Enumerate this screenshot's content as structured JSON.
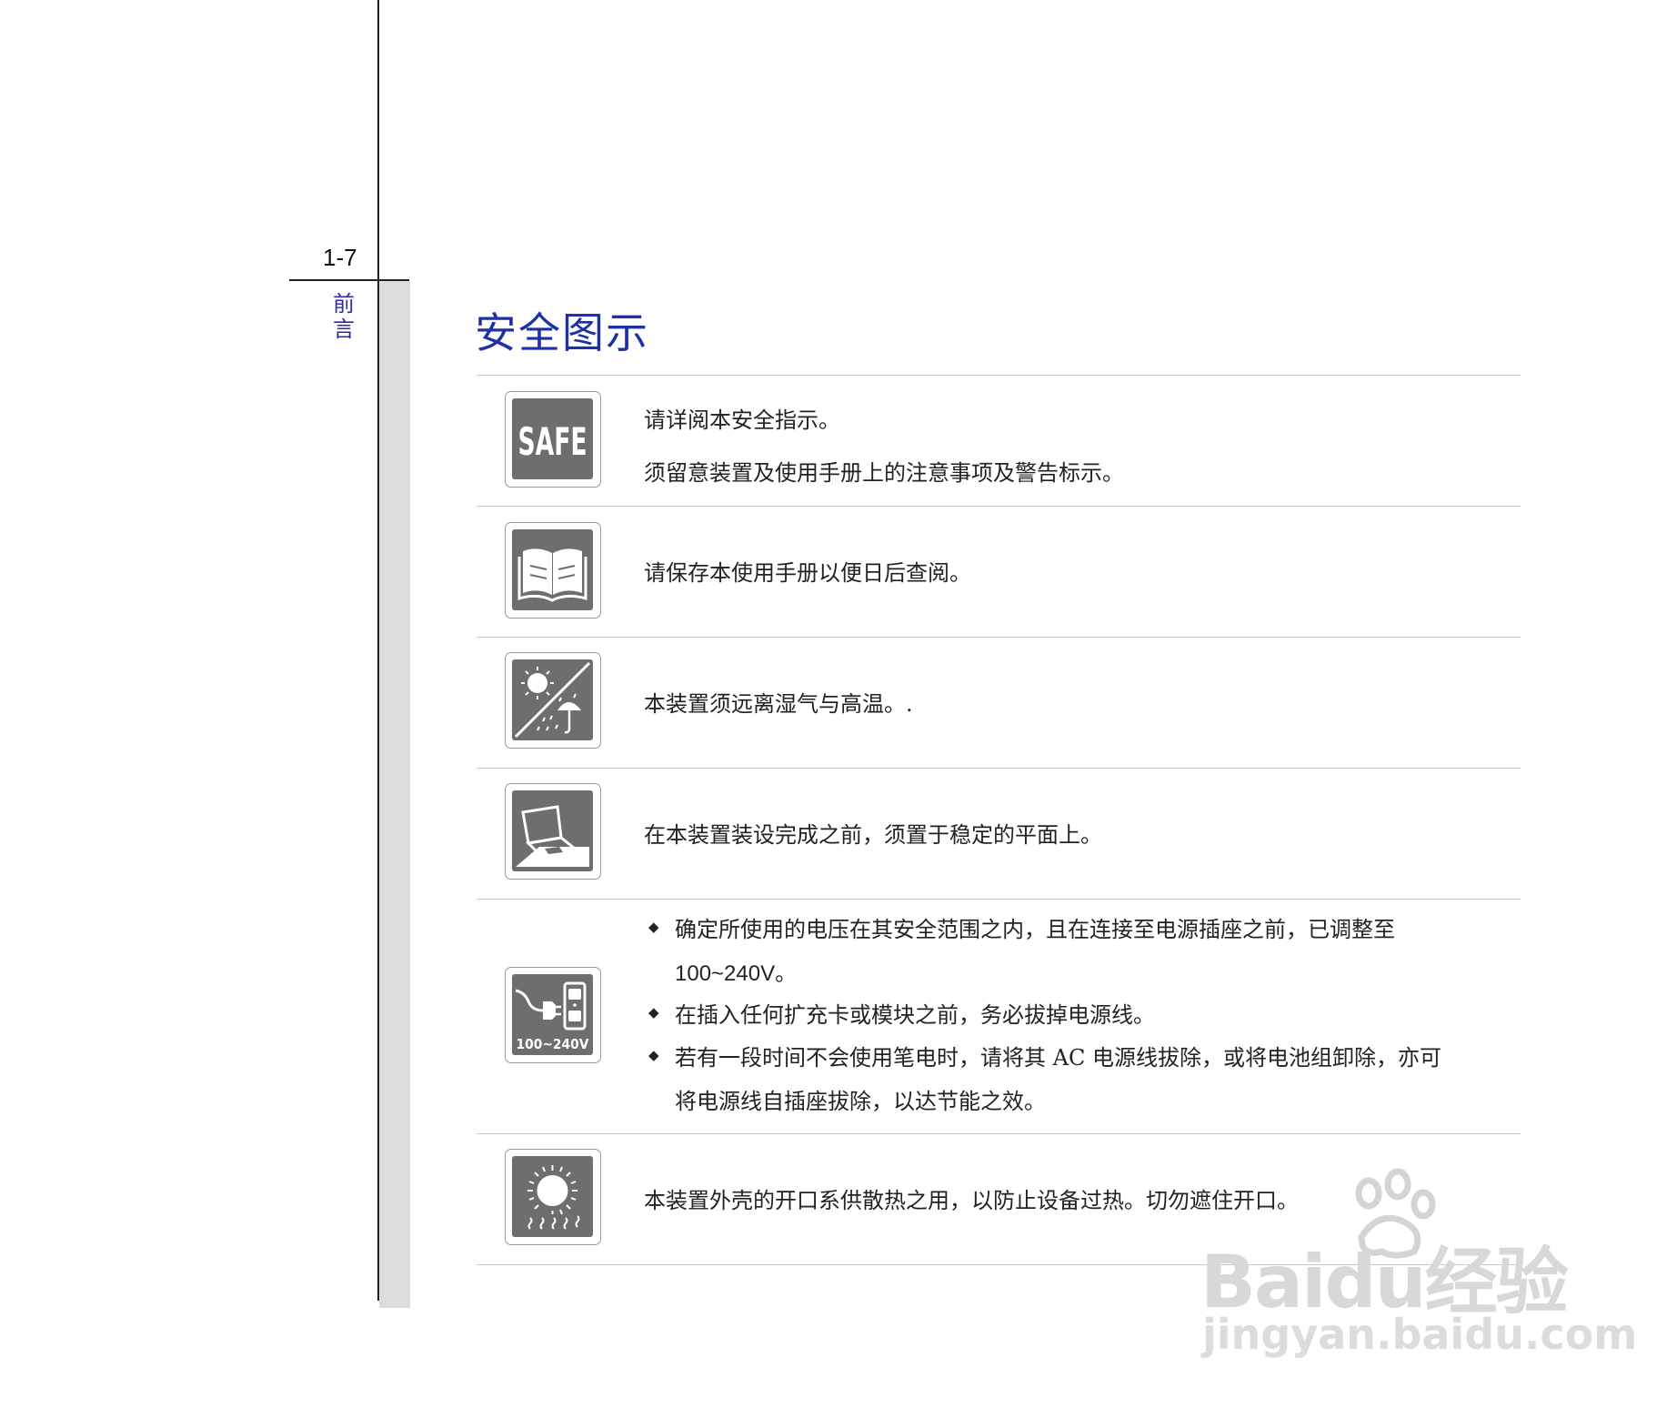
{
  "page": {
    "number": "1-7",
    "side_label": [
      "前",
      "言"
    ],
    "title": "安全图示"
  },
  "items": [
    {
      "icon": "safe-icon",
      "icon_text": "SAFE",
      "lines": [
        "请详阅本安全指示。",
        "须留意装置及使用手册上的注意事项及警告标示。"
      ]
    },
    {
      "icon": "book-icon",
      "lines": [
        "请保存本使用手册以便日后查阅。"
      ]
    },
    {
      "icon": "sun-rain-icon",
      "lines": [
        "本装置须远离湿气与高温。."
      ]
    },
    {
      "icon": "laptop-flat-icon",
      "lines": [
        "在本装置装设完成之前，须置于稳定的平面上。"
      ]
    },
    {
      "icon": "power-plug-icon",
      "icon_text": "100~240V",
      "bullet_symbol": "◆",
      "bullets": [
        [
          "确定所使用的电压在其安全范围之内，且在连接至电源插座之前，已调整至",
          "100~240V。"
        ],
        [
          "在插入任何扩充卡或模块之前，务必拔掉电源线。"
        ],
        [
          "若有一段时间不会使用笔电时，请将其 AC 电源线拔除，或将电池组卸除，亦可",
          "将电源线自插座拔除，以达节能之效。"
        ]
      ]
    },
    {
      "icon": "heat-icon",
      "lines": [
        "本装置外壳的开口系供散热之用，以防止设备过热。切勿遮住开口。"
      ]
    }
  ],
  "watermark": {
    "brand": "Bai",
    "brand_suffix": "du",
    "brand_cn": "经验",
    "url": "jingyan.baidu.com"
  },
  "colors": {
    "title": "#1f2fa8",
    "icon_fill": "#6e6e6e",
    "rule": "#c8c8c8",
    "side_strip": "#dcdcdc"
  }
}
